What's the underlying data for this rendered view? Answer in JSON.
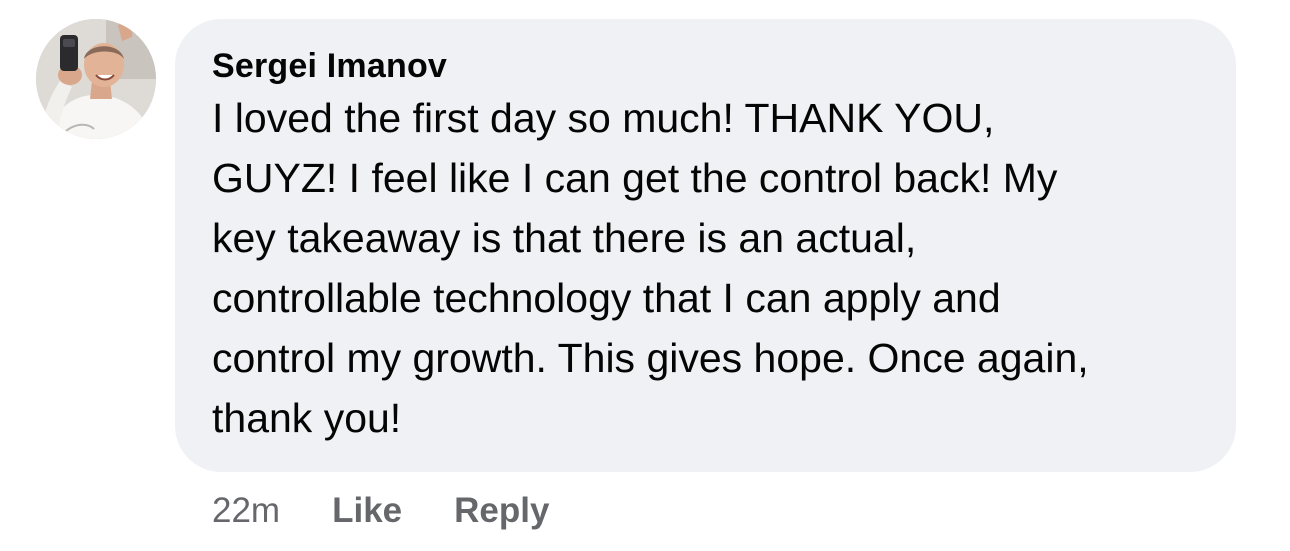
{
  "comment": {
    "author": "Sergei Imanov",
    "text_lines": [
      "I loved the first day so much! THANK YOU,",
      "GUYZ! I feel like I can get the control back! My",
      "key takeaway is that there is an actual,",
      "controllable technology that I can apply and",
      "control my growth. This gives hope. Once again,",
      "thank you!"
    ],
    "timestamp": "22m",
    "like_label": "Like",
    "reply_label": "Reply",
    "avatar_icon": "user-avatar-photo"
  },
  "colors": {
    "bubble_bg": "#f0f1f4",
    "text": "#050505",
    "secondary_text": "#65676b"
  }
}
